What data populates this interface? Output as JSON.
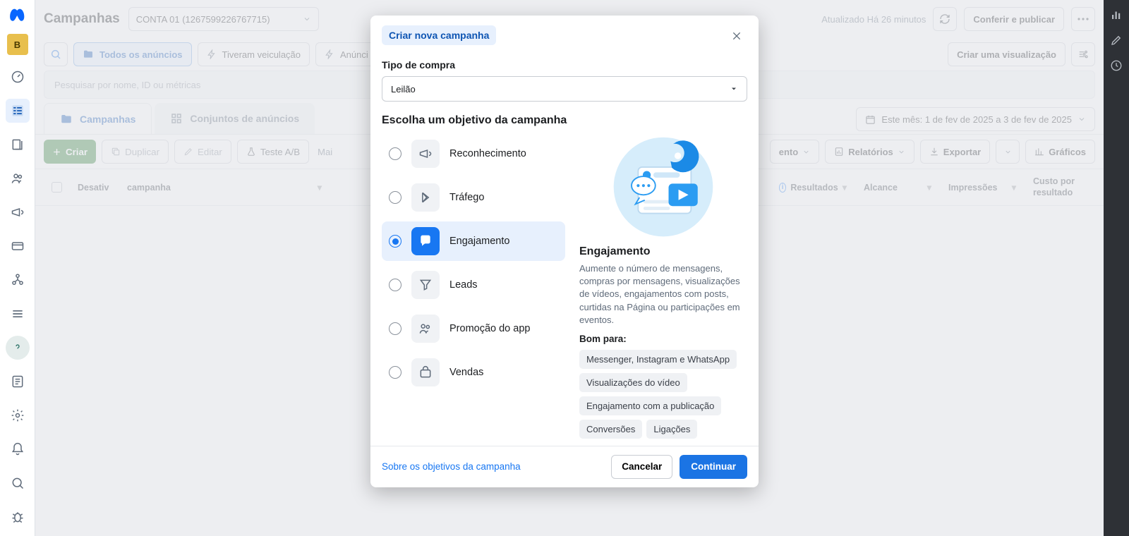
{
  "leftRail": {
    "accountInitial": "B"
  },
  "header": {
    "title": "Campanhas",
    "account": "CONTA 01 (1267599226767715)",
    "updated": "Atualizado Há 26 minutos",
    "reviewPublish": "Conferir e publicar"
  },
  "filterBar": {
    "allAds": "Todos os anúncios",
    "hadDelivery": "Tiveram veiculação",
    "ads": "Anúnci",
    "createView": "Criar uma visualização"
  },
  "searchPlaceholder": "Pesquisar por nome, ID ou métricas",
  "tabs": {
    "campaigns": "Campanhas",
    "adsets": "Conjuntos de anúncios",
    "dateRange": "Este mês: 1 de fev de 2025 a 3 de fev de 2025"
  },
  "toolbar": {
    "create": "Criar",
    "duplicate": "Duplicar",
    "edit": "Editar",
    "abtest": "Teste A/B",
    "more": "Mai",
    "delivery": "ento",
    "reports": "Relatórios",
    "export": "Exportar",
    "charts": "Gráficos"
  },
  "table": {
    "off": "Desativ",
    "campaign": "campanha",
    "results": "Resultados",
    "reach": "Alcance",
    "impressions": "Impressões",
    "costPer": "Custo por resultado"
  },
  "modal": {
    "title": "Criar nova campanha",
    "buyingTypeLabel": "Tipo de compra",
    "buyingType": "Leilão",
    "objectiveHeading": "Escolha um objetivo da campanha",
    "objectives": [
      {
        "key": "awareness",
        "label": "Reconhecimento"
      },
      {
        "key": "traffic",
        "label": "Tráfego"
      },
      {
        "key": "engagement",
        "label": "Engajamento"
      },
      {
        "key": "leads",
        "label": "Leads"
      },
      {
        "key": "app",
        "label": "Promoção do app"
      },
      {
        "key": "sales",
        "label": "Vendas"
      }
    ],
    "selectedIndex": 2,
    "detail": {
      "title": "Engajamento",
      "desc": "Aumente o número de mensagens, compras por mensagens, visualizações de vídeos, engajamentos com posts, curtidas na Página ou participações em eventos.",
      "goodForLabel": "Bom para:",
      "tags": [
        "Messenger, Instagram e WhatsApp",
        "Visualizações do vídeo",
        "Engajamento com a publicação",
        "Conversões",
        "Ligações"
      ]
    },
    "footer": {
      "about": "Sobre os objetivos da campanha",
      "cancel": "Cancelar",
      "continue": "Continuar"
    }
  }
}
